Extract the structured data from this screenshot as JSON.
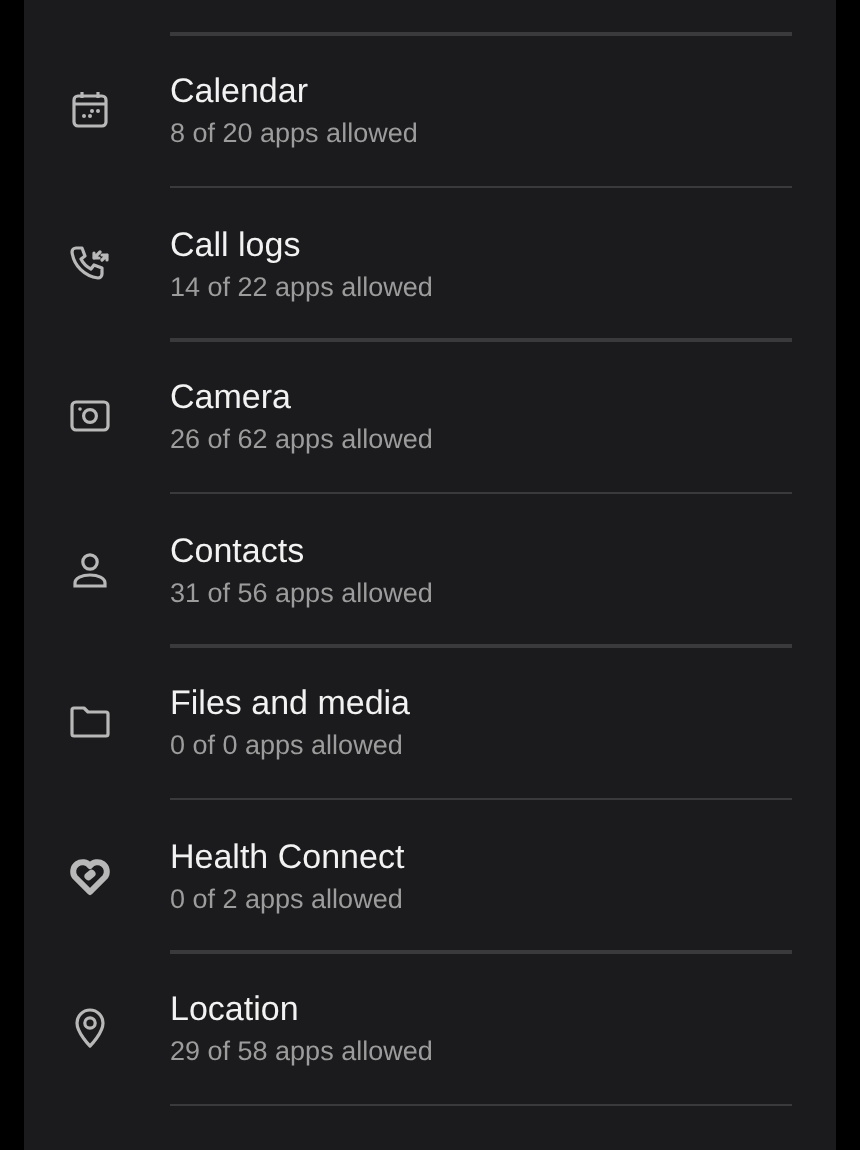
{
  "permissions": [
    {
      "kind": "calendar",
      "title": "Calendar",
      "subtitle": "8 of 20 apps allowed"
    },
    {
      "kind": "calllog",
      "title": "Call logs",
      "subtitle": "14 of 22 apps allowed"
    },
    {
      "kind": "camera",
      "title": "Camera",
      "subtitle": "26 of 62 apps allowed"
    },
    {
      "kind": "contacts",
      "title": "Contacts",
      "subtitle": "31 of 56 apps allowed"
    },
    {
      "kind": "files",
      "title": "Files and media",
      "subtitle": "0 of 0 apps allowed"
    },
    {
      "kind": "health",
      "title": "Health Connect",
      "subtitle": "0 of 2 apps allowed"
    },
    {
      "kind": "location",
      "title": "Location",
      "subtitle": "29 of 58 apps allowed"
    }
  ]
}
